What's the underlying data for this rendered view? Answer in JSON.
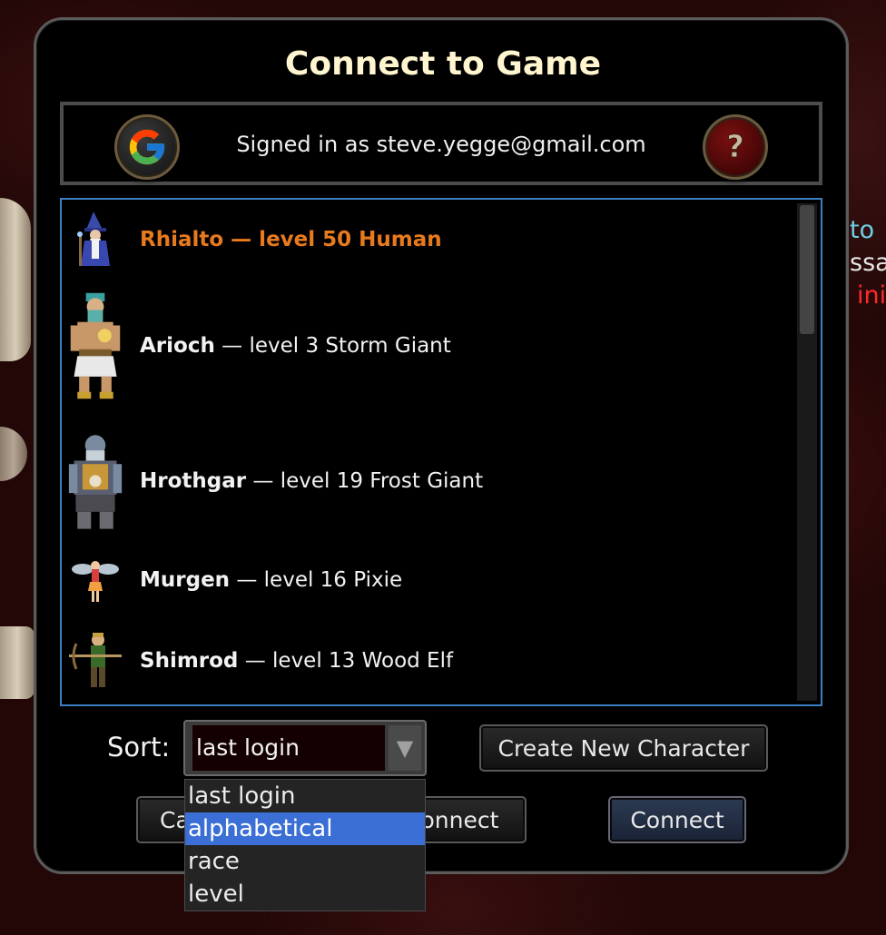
{
  "background": {
    "fragments": [
      "to",
      "ssa",
      "ini"
    ]
  },
  "dialog": {
    "title": "Connect to Game",
    "signin_text": "Signed in as steve.yegge@gmail.com",
    "google_icon": "google-logo-icon",
    "help_icon": "question-mark-icon"
  },
  "characters": [
    {
      "name": "Rhialto",
      "detail": " — level 50 Human",
      "selected": true,
      "sprite": "wizard-sprite"
    },
    {
      "name": "Arioch",
      "detail": " — level 3 Storm Giant",
      "selected": false,
      "sprite": "storm-giant-sprite"
    },
    {
      "name": "Hrothgar",
      "detail": " — level 19 Frost Giant",
      "selected": false,
      "sprite": "frost-giant-sprite"
    },
    {
      "name": "Murgen",
      "detail": " — level 16 Pixie",
      "selected": false,
      "sprite": "pixie-sprite"
    },
    {
      "name": "Shimrod",
      "detail": " — level 13 Wood Elf",
      "selected": false,
      "sprite": "wood-elf-sprite"
    }
  ],
  "sort": {
    "label": "Sort:",
    "selected": "last login",
    "options": [
      "last login",
      "alphabetical",
      "race",
      "level"
    ],
    "highlighted": "alphabetical"
  },
  "buttons": {
    "create": "Create New Character",
    "cancel": "Ca",
    "dev_connect": "Dev Connect",
    "connect": "Connect"
  },
  "colors": {
    "selected_character": "#e87a1e",
    "title": "#fff6d0",
    "list_border": "#3d7fc4",
    "dropdown_highlight": "#3b6fd6"
  }
}
